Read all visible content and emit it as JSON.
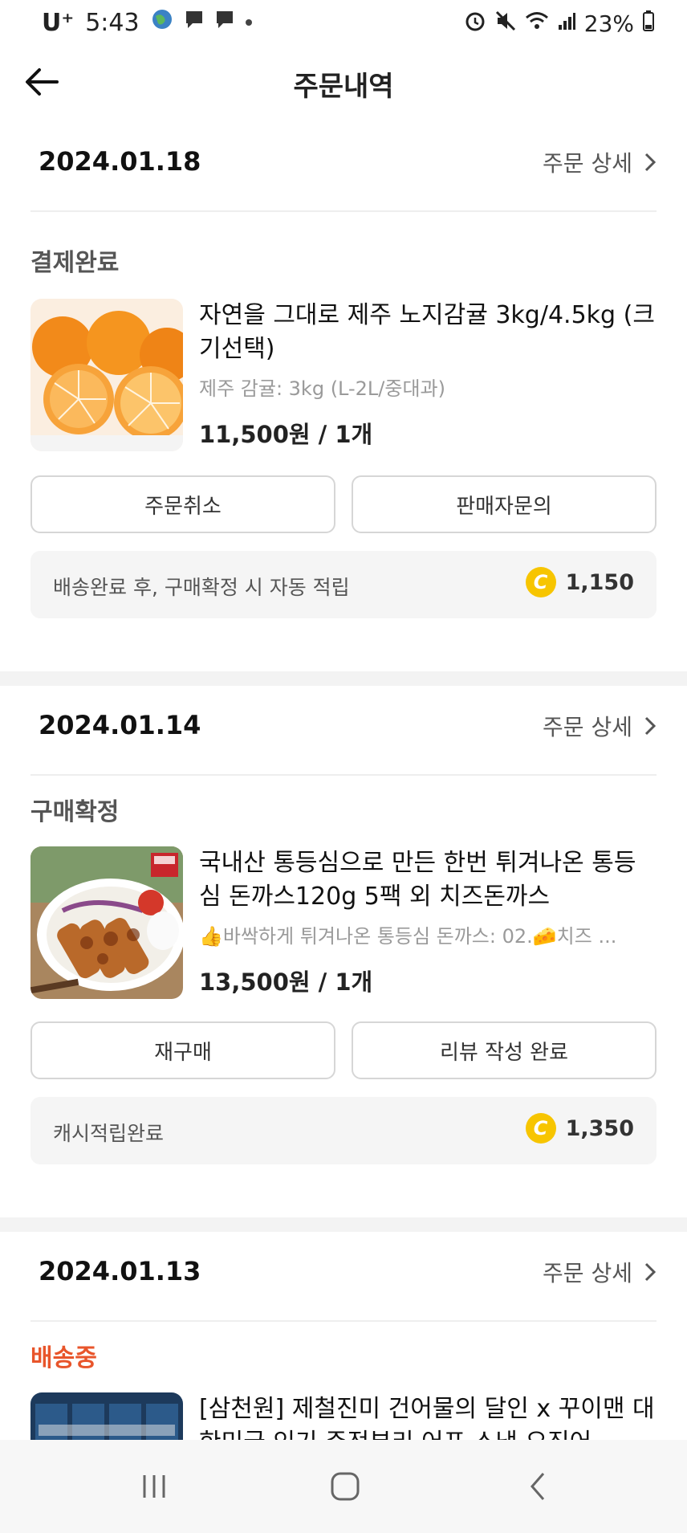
{
  "status_bar": {
    "carrier": "U⁺",
    "time": "5:43",
    "battery": "23%"
  },
  "header": {
    "title": "주문내역"
  },
  "orders": [
    {
      "date": "2024.01.18",
      "detail_label": "주문 상세",
      "status": "결제완료",
      "product_name": "자연을 그대로 제주 노지감귤 3kg/4.5kg (크기선택)",
      "option": "제주 감귤: 3kg (L-2L/중대과)",
      "price": "11,500원 / 1개",
      "button_left": "주문취소",
      "button_right": "판매자문의",
      "cash_text": "배송완료 후, 구매확정 시 자동 적립",
      "cash_amount": "1,150"
    },
    {
      "date": "2024.01.14",
      "detail_label": "주문 상세",
      "status": "구매확정",
      "product_name": "국내산 통등심으로 만든 한번 튀겨나온 통등심 돈까스120g 5팩 외 치즈돈까스",
      "option": "👍바싹하게 튀겨나온 통등심 돈까스: 02.🧀치즈 ...",
      "price": "13,500원 / 1개",
      "button_left": "재구매",
      "button_right": "리뷰 작성 완료",
      "cash_text": "캐시적립완료",
      "cash_amount": "1,350"
    },
    {
      "date": "2024.01.13",
      "detail_label": "주문 상세",
      "status": "배송중",
      "product_name": "[삼천원] 제철진미 건어물의 달인 x 꾸이맨 대한민국 인기 주전부리 어포 스낵 오징어"
    }
  ],
  "colors": {
    "shipping_status": "#e8552b",
    "coin": "#f7c500"
  },
  "icons": [
    "back-arrow-icon",
    "chevron-right-icon",
    "cash-coin-icon",
    "nav-recent-icon",
    "nav-home-icon",
    "nav-back-icon"
  ]
}
